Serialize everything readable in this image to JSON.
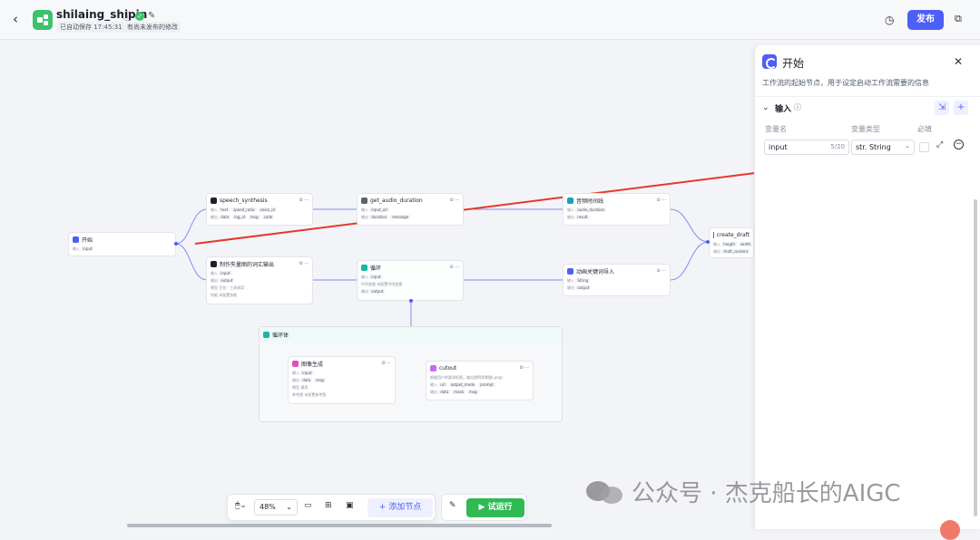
{
  "header": {
    "back_icon": "chevron-left-icon",
    "app_name": "shilaing_shipin",
    "autosave": "已自动保存 17:45:31",
    "unpublished": "有尚未发布的修改",
    "publish_label": "发布",
    "accent": "#4e5ff5"
  },
  "nodes": {
    "start": {
      "title": "开始",
      "row1_label": "输入",
      "row1_value": "input"
    },
    "speech": {
      "title": "speech_synthesis",
      "in_label": "输入",
      "in_values": [
        "text",
        "speed_ratio",
        "voice_id"
      ],
      "out_label": "输出",
      "out_values": [
        "data",
        "log_id",
        "msg",
        "code"
      ]
    },
    "audio": {
      "title": "get_audio_duration",
      "in_label": "输入",
      "in_value": "input_url",
      "out_label": "输出",
      "out_values": [
        "duration",
        "message"
      ]
    },
    "timeline": {
      "title": "音频时间线",
      "in_label": "输入",
      "in_value": "audio_duration",
      "out_label": "输出",
      "out_value": "result"
    },
    "draft": {
      "title": "create_draft",
      "in_label": "输入",
      "in_values": [
        "height",
        "width"
      ],
      "out_label": "输出",
      "out_value": "draft_content"
    },
    "prompt": {
      "title": "制作失量图的词汇输出",
      "in_label": "输入",
      "in_value": "input",
      "out_label": "输出",
      "out_value": "output",
      "model_label": "模型",
      "model_value": "豆包 · 工具调用",
      "skill_label": "技能",
      "skill_value": "未配置技能"
    },
    "loop": {
      "title": "循环",
      "in_label": "输入",
      "in_value": "input",
      "mid_label": "中间变量",
      "mid_value": "未配置中间变量",
      "out_label": "输出",
      "out_value": "output"
    },
    "keywords": {
      "title": "动画关键词导入",
      "in_label": "输入",
      "in_value": "String",
      "out_label": "输出",
      "out_value": "output"
    },
    "loop_body": {
      "title": "循环体"
    },
    "image_gen": {
      "title": "图像生成",
      "in_label": "输入",
      "in_value": "input",
      "out_label": "输出",
      "out_values": [
        "data",
        "msg"
      ],
      "model_label": "模型",
      "model_value": "通用",
      "ref_label": "参考图",
      "ref_value": "未配置参考图"
    },
    "cutout": {
      "title": "cutout",
      "desc": "根据用户的要求抠图，输出透明背景图(.png)",
      "in_label": "输入",
      "in_values": [
        "url",
        "output_mode",
        "prompt"
      ],
      "out_label": "输出",
      "out_values": [
        "data",
        "mask",
        "msg"
      ]
    }
  },
  "panel": {
    "title": "开始",
    "description": "工作流的起始节点，用于设定启动工作流需要的信息",
    "section_title": "输入",
    "col_name": "变量名",
    "col_type": "变量类型",
    "col_required": "必填",
    "var_name": "input",
    "var_count": "5/20",
    "var_type": "str. String"
  },
  "toolbar": {
    "zoom": "48%",
    "add_node": "添加节点",
    "run": "试运行"
  },
  "watermark": "公众号 · 杰克船长的AIGC",
  "colors": {
    "edge": "#4e5ff5",
    "arrow": "#e5392a",
    "run": "#2fba53"
  }
}
